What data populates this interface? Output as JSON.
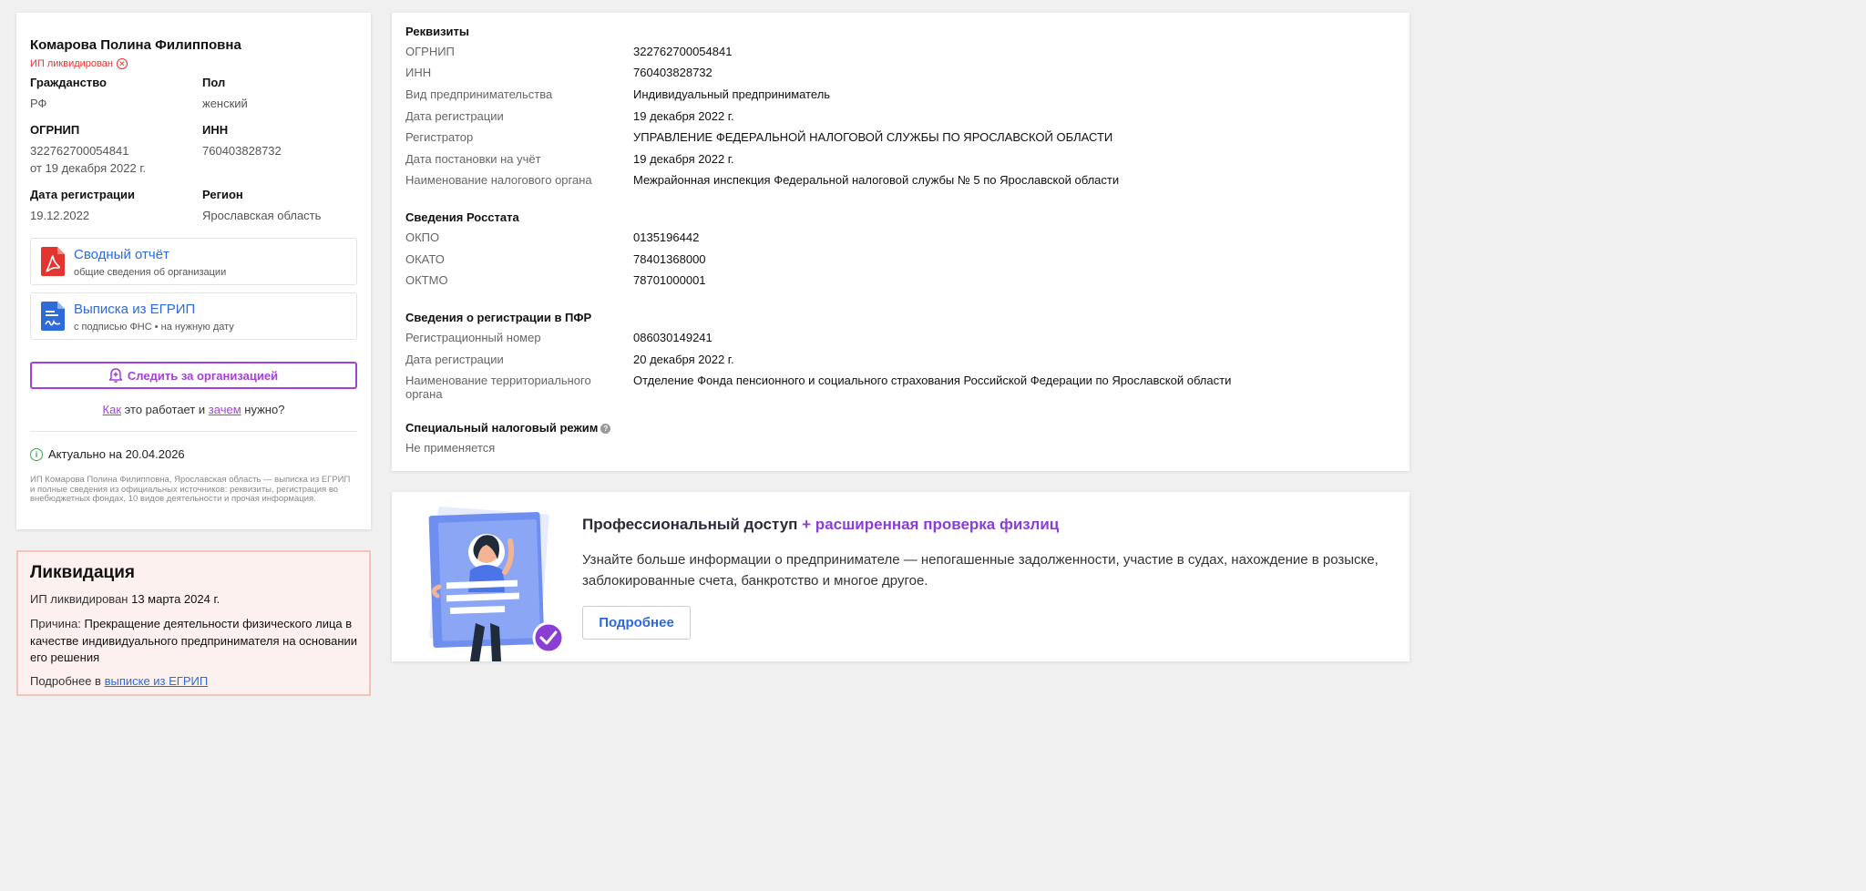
{
  "person": {
    "name": "Комарова Полина Филипповна",
    "status": "ИП ликвидирован",
    "status_icon": "close-circle-icon"
  },
  "fields": {
    "citizenship_label": "Гражданство",
    "citizenship_value": "РФ",
    "gender_label": "Пол",
    "gender_value": "женский",
    "ogrnip_label": "ОГРНИП",
    "ogrnip_value": "322762700054841",
    "ogrnip_date": "от 19 декабря 2022 г.",
    "inn_label": "ИНН",
    "inn_value": "760403828732",
    "regdate_label": "Дата регистрации",
    "regdate_value": "19.12.2022",
    "region_label": "Регион",
    "region_value": "Ярославская область"
  },
  "documents": [
    {
      "title": "Сводный отчёт",
      "subtitle": "общие сведения об организации",
      "icon": "pdf-file-icon",
      "color": "#e3342f"
    },
    {
      "title": "Выписка из ЕГРИП",
      "subtitle": "с подписью ФНС • на нужную дату",
      "icon": "signed-document-icon",
      "color": "#2c6bd8"
    }
  ],
  "follow": {
    "label": "Следить за организацией",
    "icon": "bell-plus-icon",
    "how_link1": "Как",
    "how_mid": " это работает и ",
    "how_link2": "зачем",
    "how_end": " нужно?"
  },
  "actual": {
    "text": "Актуально на 20.04.2026",
    "icon": "info-icon"
  },
  "description": "ИП Комарова Полина Филипповна, Ярославская область — выписка из ЕГРИП и полные сведения из официальных источников: реквизиты, регистрация во внебюджетных фондах, 10 видов деятельности и прочая информация.",
  "liquidation": {
    "title": "Ликвидация",
    "line1_prefix": "ИП ликвидирован ",
    "line1_date": "13 марта 2024 г.",
    "reason_prefix": "Причина: ",
    "reason": "Прекращение деятельности физического лица в качестве индивидуального предпринимателя на основании его решения",
    "more_prefix": "Подробнее в ",
    "more_link": "выписке из ЕГРИП"
  },
  "requisites": {
    "title": "Реквизиты",
    "rows": [
      {
        "label": "ОГРНИП",
        "value": "322762700054841"
      },
      {
        "label": "ИНН",
        "value": "760403828732"
      },
      {
        "label": "Вид предпринимательства",
        "value": "Индивидуальный предприниматель"
      },
      {
        "label": "Дата регистрации",
        "value": "19 декабря 2022 г."
      },
      {
        "label": "Регистратор",
        "value": "УПРАВЛЕНИЕ ФЕДЕРАЛЬНОЙ НАЛОГОВОЙ СЛУЖБЫ ПО ЯРОСЛАВСКОЙ ОБЛАСТИ"
      },
      {
        "label": "Дата постановки на учёт",
        "value": "19 декабря 2022 г."
      },
      {
        "label": "Наименование налогового органа",
        "value": "Межрайонная инспекция Федеральной налоговой службы № 5 по Ярославской области"
      }
    ]
  },
  "rosstat": {
    "title": "Сведения Росстата",
    "rows": [
      {
        "label": "ОКПО",
        "value": "0135196442"
      },
      {
        "label": "ОКАТО",
        "value": "78401368000"
      },
      {
        "label": "ОКТМО",
        "value": "78701000001"
      }
    ]
  },
  "pfr": {
    "title": "Сведения о регистрации в ПФР",
    "rows": [
      {
        "label": "Регистрационный номер",
        "value": "086030149241"
      },
      {
        "label": "Дата регистрации",
        "value": "20 декабря 2022 г."
      },
      {
        "label": "Наименование территориального органа",
        "value": "Отделение Фонда пенсионного и социального страхования Российской Федерации по Ярославской области"
      }
    ]
  },
  "tax_regime": {
    "title": "Специальный налоговый режим",
    "help_icon": "question-icon",
    "value": "Не применяется"
  },
  "promo": {
    "title_main": "Профессиональный доступ",
    "title_accent": " + расширенная проверка физлиц",
    "text": "Узнайте больше информации о предпринимателе — непогашенные задолженности, участие в судах, нахождение в розыске, заблокированные счета, банкротство и многое другое.",
    "button": "Подробнее",
    "accent_color": "#8a3ed6"
  }
}
